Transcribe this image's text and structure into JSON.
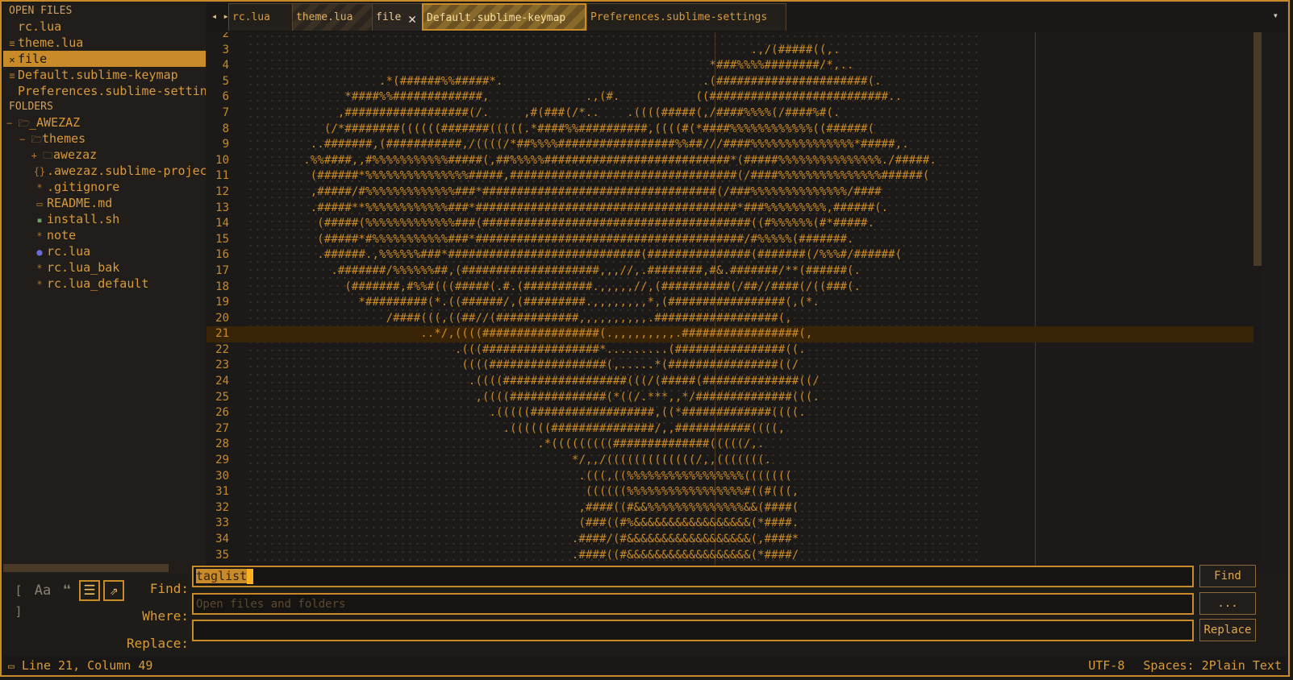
{
  "sidebar": {
    "open_files_header": "OPEN FILES",
    "open_files": [
      {
        "label": "rc.lua",
        "icon": ""
      },
      {
        "label": "theme.lua",
        "icon": "≡"
      },
      {
        "label": "file",
        "icon": "✕",
        "active": true
      },
      {
        "label": "Default.sublime-keymap",
        "icon": "≡"
      },
      {
        "label": "Preferences.sublime-settings",
        "icon": ""
      }
    ],
    "folders_header": "FOLDERS",
    "folders": [
      {
        "label": "_AWEZAZ",
        "icon": "− 🗁"
      },
      {
        "label": "themes",
        "icon": "− 🗁"
      },
      {
        "label": "awezaz",
        "icon": "+ 🗀"
      },
      {
        "label": ".awezaz.sublime-project",
        "icon": "{}"
      },
      {
        "label": ".gitignore",
        "icon": "*"
      },
      {
        "label": "README.md",
        "icon": "▭"
      },
      {
        "label": "install.sh",
        "icon": "▪"
      },
      {
        "label": "note",
        "icon": "*"
      },
      {
        "label": "rc.lua",
        "icon": "●"
      },
      {
        "label": "rc.lua_bak",
        "icon": "*"
      },
      {
        "label": "rc.lua_default",
        "icon": "*"
      }
    ]
  },
  "tabs": {
    "nav_arrows": "◂ ▸",
    "items": [
      "rc.lua",
      "theme.lua",
      "file",
      "Default.sublime-keymap",
      "Preferences.sublime-settings"
    ],
    "close_glyph": "✕",
    "dropdown_glyph": "▾"
  },
  "editor": {
    "current_line": "21",
    "lines": [
      {
        "n": "2",
        "t": ""
      },
      {
        "n": "3",
        "t": "                                                                         .,/(#####((,."
      },
      {
        "n": "4",
        "t": "                                                                   *###%%%%########/*,.."
      },
      {
        "n": "5",
        "t": "                   .*(######%%#####*.                             .(######################(."
      },
      {
        "n": "6",
        "t": "              *####%%#############,              .,(#.           ((##########################.."
      },
      {
        "n": "7",
        "t": "             ,##################(/.     ,#(###(/*..    .((((#####(,/####%%%%(/####%#(."
      },
      {
        "n": "8",
        "t": "           (/*########((((((#######(((((.*####%%##########,((((#(*####%%%%%%%%%%%%((######("
      },
      {
        "n": "9",
        "t": "         ..#######,(###########,/((((/*##%%%%#################%%##///####%%%%%%%%%%%%%%%*#####,."
      },
      {
        "n": "10",
        "t": "        .%%####,,#%%%%%%%%%%%#####(,##%%%%%###########################*(#####%%%%%%%%%%%%%%%./#####."
      },
      {
        "n": "11",
        "t": "         (######*%%%%%%%%%%%%%%%#####,#################################(/####%%%%%%%%%%%%%%%######("
      },
      {
        "n": "12",
        "t": "         ,#####/#%%%%%%%%%%%%%###*##################################(/###%%%%%%%%%%%%%%/####"
      },
      {
        "n": "13",
        "t": "         .#####**%%%%%%%%%%%%###*######################################*###%%%%%%%%%,######(."
      },
      {
        "n": "14",
        "t": "          (#####(%%%%%%%%%%%%%###(#######################################((#%%%%%%(#*#####."
      },
      {
        "n": "15",
        "t": "          (#####*#%%%%%%%%%%%###*#######################################/#%%%%%(#######."
      },
      {
        "n": "16",
        "t": "          .######.,%%%%%%###*############################(###############(#######(/%%%#/######("
      },
      {
        "n": "17",
        "t": "            .#######/%%%%%%##,(####################,,,//,.########,#&.#######/**(######(."
      },
      {
        "n": "18",
        "t": "              (#######,#%%#(((#####(.#.(##########.,,,,,//,(##########(/##//####(/((###(."
      },
      {
        "n": "19",
        "t": "                *#########(*.((######/,(#########.,,,,,,,,*,(#################(,(*."
      },
      {
        "n": "20",
        "t": "                    /####(((,((##//(############,,,,,,,,,,.##################(,"
      },
      {
        "n": "21",
        "t": "                         ..*/,((((#################(.,,,,,,,,,.#################(,"
      },
      {
        "n": "22",
        "t": "                              .(((#################*.........(################((."
      },
      {
        "n": "23",
        "t": "                               ((((#################(,.....*(################((/"
      },
      {
        "n": "24",
        "t": "                                .((((##################(((/(#####(##############((/"
      },
      {
        "n": "25",
        "t": "                                 ,((((##############(*((/.***,,*/##############(((."
      },
      {
        "n": "26",
        "t": "                                   .(((((##################,((*#############((((."
      },
      {
        "n": "27",
        "t": "                                     .((((((###############/,,###########((((,"
      },
      {
        "n": "28",
        "t": "                                          .*(((((((((##############(((((/,."
      },
      {
        "n": "29",
        "t": "                                               */,,/(((((((((((((/,,(((((((."
      },
      {
        "n": "30",
        "t": "                                                .(((,((%%%%%%%%%%%%%%%%%((((((("
      },
      {
        "n": "31",
        "t": "                                                 ((((((%%%%%%%%%%%%%%%%%#((#(((,"
      },
      {
        "n": "32",
        "t": "                                                ,####((#&&%%%%%%%%%%%%%%&&(####("
      },
      {
        "n": "33",
        "t": "                                                (###((#%&&&&&&&&&&&&&&&&&(*####."
      },
      {
        "n": "34",
        "t": "                                               .####/(#&&&&&&&&&&&&&&&&&&(,####*"
      },
      {
        "n": "35",
        "t": "                                               .####((#&&&&&&&&&&&&&&&&&&(*####/"
      }
    ]
  },
  "find": {
    "find_label": "Find:",
    "find_value": "taglist",
    "where_label": "Where:",
    "where_placeholder": "Open files and folders",
    "replace_label": "Replace:",
    "replace_value": "",
    "find_button": "Find",
    "where_button": "...",
    "replace_button": "Replace",
    "option_icons": [
      "regex-icon",
      "case-icon",
      "whole-word-icon",
      "show-context-icon",
      "use-buffer-icon"
    ]
  },
  "status": {
    "position": "Line 21, Column 49",
    "encoding": "UTF-8",
    "indent": "Spaces: 2",
    "syntax": "Plain Text"
  },
  "colors": {
    "accent": "#c98a2a",
    "text": "#d99a3a",
    "background": "#1c1a18",
    "current_line": "#3a2408"
  }
}
